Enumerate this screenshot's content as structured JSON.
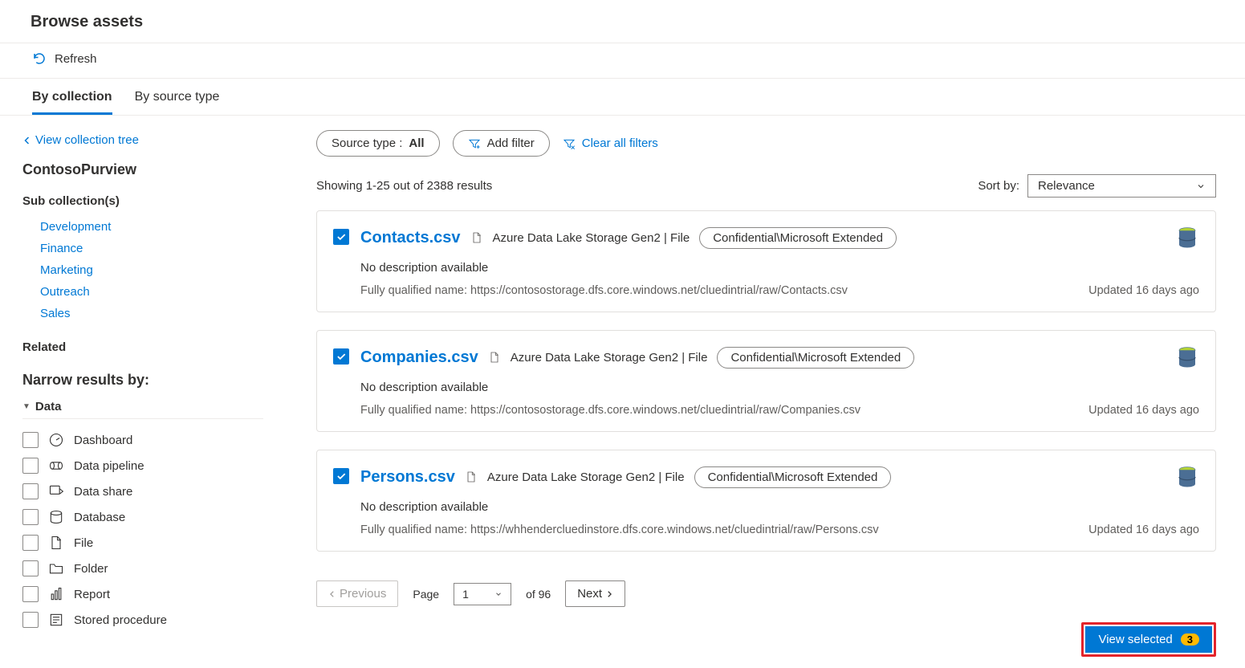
{
  "page_title": "Browse assets",
  "refresh_label": "Refresh",
  "tabs": [
    {
      "label": "By collection",
      "active": true
    },
    {
      "label": "By source type",
      "active": false
    }
  ],
  "sidebar": {
    "view_tree_label": "View collection tree",
    "collection_name": "ContosoPurview",
    "sub_collections_heading": "Sub collection(s)",
    "sub_collections": [
      "Development",
      "Finance",
      "Marketing",
      "Outreach",
      "Sales"
    ],
    "related_heading": "Related",
    "narrow_heading": "Narrow results by:",
    "facet_group_label": "Data",
    "facets": [
      {
        "icon": "gauge",
        "label": "Dashboard"
      },
      {
        "icon": "pipeline",
        "label": "Data pipeline"
      },
      {
        "icon": "share",
        "label": "Data share"
      },
      {
        "icon": "database",
        "label": "Database"
      },
      {
        "icon": "file",
        "label": "File"
      },
      {
        "icon": "folder",
        "label": "Folder"
      },
      {
        "icon": "report",
        "label": "Report"
      },
      {
        "icon": "sproc",
        "label": "Stored procedure"
      }
    ]
  },
  "filters": {
    "source_type_label": "Source type :",
    "source_type_value": "All",
    "add_filter_label": "Add filter",
    "clear_label": "Clear all filters"
  },
  "results": {
    "showing_text": "Showing 1-25 out of 2388 results",
    "sort_label": "Sort by:",
    "sort_value": "Relevance",
    "items": [
      {
        "title": "Contacts.csv",
        "source": "Azure Data Lake Storage Gen2 | File",
        "classification": "Confidential\\Microsoft Extended",
        "description": "No description available",
        "fqn": "Fully qualified name: https://contosostorage.dfs.core.windows.net/cluedintrial/raw/Contacts.csv",
        "updated": "Updated 16 days ago",
        "checked": true
      },
      {
        "title": "Companies.csv",
        "source": "Azure Data Lake Storage Gen2 | File",
        "classification": "Confidential\\Microsoft Extended",
        "description": "No description available",
        "fqn": "Fully qualified name: https://contosostorage.dfs.core.windows.net/cluedintrial/raw/Companies.csv",
        "updated": "Updated 16 days ago",
        "checked": true
      },
      {
        "title": "Persons.csv",
        "source": "Azure Data Lake Storage Gen2 | File",
        "classification": "Confidential\\Microsoft Extended",
        "description": "No description available",
        "fqn": "Fully qualified name: https://whhendercluedinstore.dfs.core.windows.net/cluedintrial/raw/Persons.csv",
        "updated": "Updated 16 days ago",
        "checked": true
      }
    ]
  },
  "pager": {
    "prev_label": "Previous",
    "page_label": "Page",
    "current_page": "1",
    "of_label": "of 96",
    "next_label": "Next"
  },
  "view_selected": {
    "label": "View selected",
    "count": "3"
  }
}
